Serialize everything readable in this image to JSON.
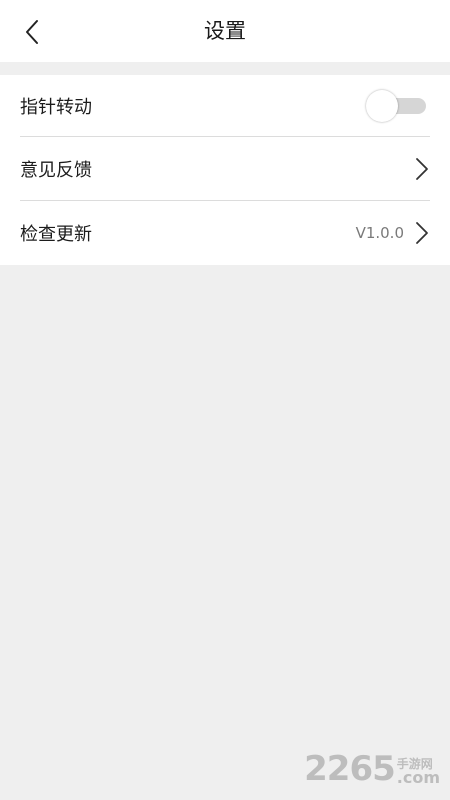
{
  "header": {
    "title": "设置",
    "back_icon": "chevron-left-icon"
  },
  "settings": {
    "pointer_rotation": {
      "label": "指针转动",
      "enabled": false
    },
    "feedback": {
      "label": "意见反馈"
    },
    "check_update": {
      "label": "检查更新",
      "version": "V1.0.0"
    }
  },
  "watermark": {
    "number": "2265",
    "site_cn": "手游网",
    "suffix": ".com"
  },
  "colors": {
    "background": "#efefef",
    "card": "#ffffff",
    "divider": "#dcdcdc",
    "toggle_track": "#d6d6d6"
  }
}
